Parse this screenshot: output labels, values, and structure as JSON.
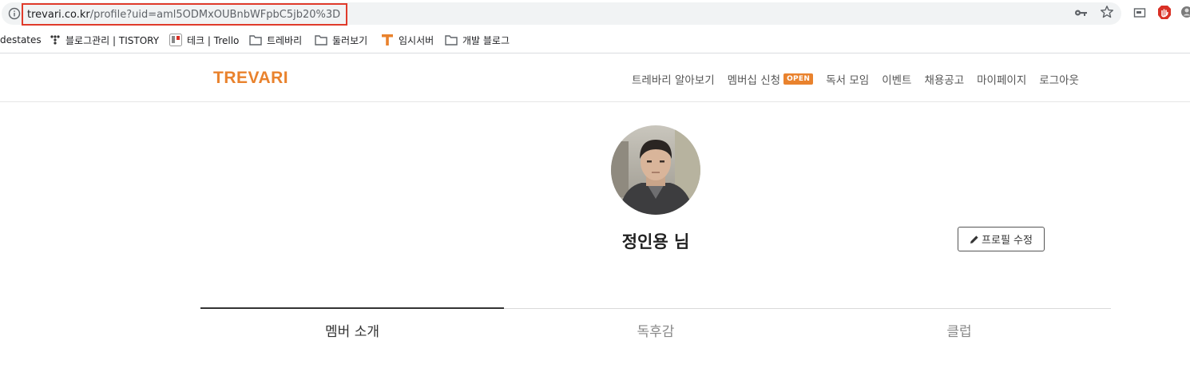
{
  "browser": {
    "url_host": "trevari.co.kr",
    "url_path": "/profile?uid=aml5ODMxOUBnbWFpbC5jb20%3D",
    "icons": [
      "info-icon",
      "key-icon",
      "star-icon",
      "cast-icon",
      "adblock-icon",
      "profile-icon"
    ]
  },
  "bookmarks": [
    {
      "label": "destates",
      "icon": "none"
    },
    {
      "label": "블로그관리 | TISTORY",
      "icon": "tistory-icon"
    },
    {
      "label": "테크 | Trello",
      "icon": "trello-icon"
    },
    {
      "label": "트레바리",
      "icon": "folder-icon"
    },
    {
      "label": "둘러보기",
      "icon": "folder-icon"
    },
    {
      "label": "임시서버",
      "icon": "t-icon"
    },
    {
      "label": "개발 블로그",
      "icon": "folder-icon"
    }
  ],
  "header": {
    "logo": "TREVARI",
    "nav": [
      {
        "label": "트레바리 알아보기"
      },
      {
        "label": "멤버십 신청",
        "badge": "OPEN"
      },
      {
        "label": "독서 모임"
      },
      {
        "label": "이벤트"
      },
      {
        "label": "채용공고"
      },
      {
        "label": "마이페이지"
      },
      {
        "label": "로그아웃"
      }
    ]
  },
  "profile": {
    "name": "정인용 님",
    "edit_label": "프로필 수정"
  },
  "tabs": [
    {
      "label": "멤버 소개",
      "active": true
    },
    {
      "label": "독후감",
      "active": false
    },
    {
      "label": "클럽",
      "active": false
    }
  ],
  "colors": {
    "brand": "#e9822d",
    "url_highlight": "#e03b2b"
  }
}
